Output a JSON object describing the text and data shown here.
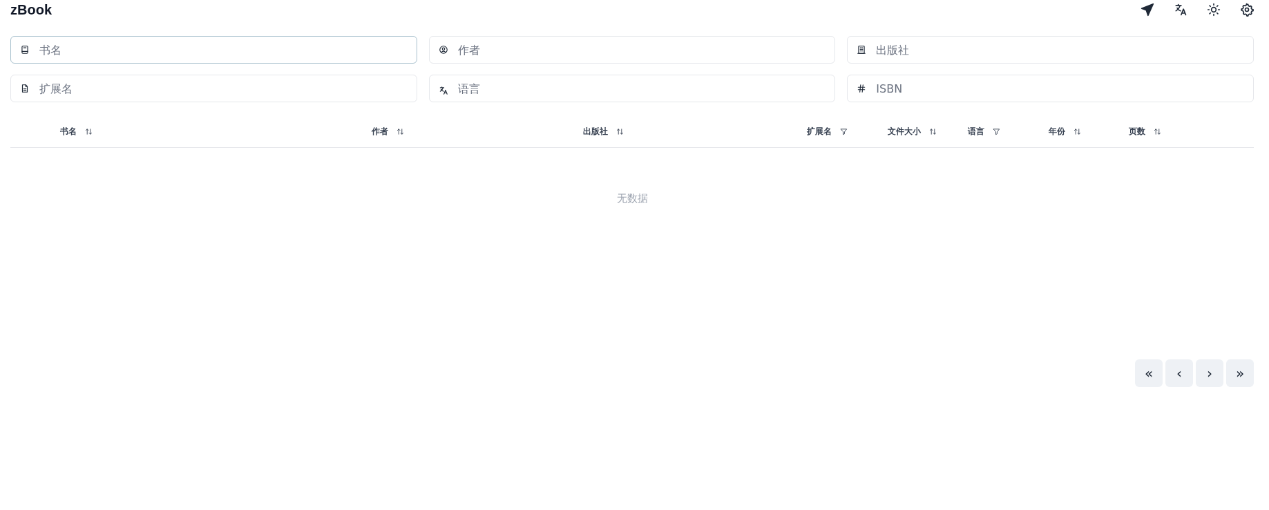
{
  "app": {
    "title": "zBook"
  },
  "toolbar": [
    {
      "kind": "send"
    },
    {
      "kind": "translate"
    },
    {
      "kind": "theme"
    },
    {
      "kind": "settings"
    }
  ],
  "filters": [
    {
      "kind": "book",
      "placeholder": "书名",
      "focused": true
    },
    {
      "kind": "user",
      "placeholder": "作者",
      "focused": false
    },
    {
      "kind": "building",
      "placeholder": "出版社",
      "focused": false
    },
    {
      "kind": "file",
      "placeholder": "扩展名",
      "focused": false
    },
    {
      "kind": "translate",
      "placeholder": "语言",
      "focused": false
    },
    {
      "kind": "hash",
      "placeholder": "ISBN",
      "focused": false
    }
  ],
  "table": {
    "columns": [
      {
        "label": "书名",
        "kind": "sort"
      },
      {
        "label": "作者",
        "kind": "sort"
      },
      {
        "label": "出版社",
        "kind": "sort"
      },
      {
        "label": "扩展名",
        "kind": "filter"
      },
      {
        "label": "文件大小",
        "kind": "sort"
      },
      {
        "label": "语言",
        "kind": "filter"
      },
      {
        "label": "年份",
        "kind": "sort"
      },
      {
        "label": "页数",
        "kind": "sort"
      }
    ],
    "empty_text": "无数据"
  },
  "pagination": [
    "«",
    "‹",
    "›",
    "»"
  ]
}
